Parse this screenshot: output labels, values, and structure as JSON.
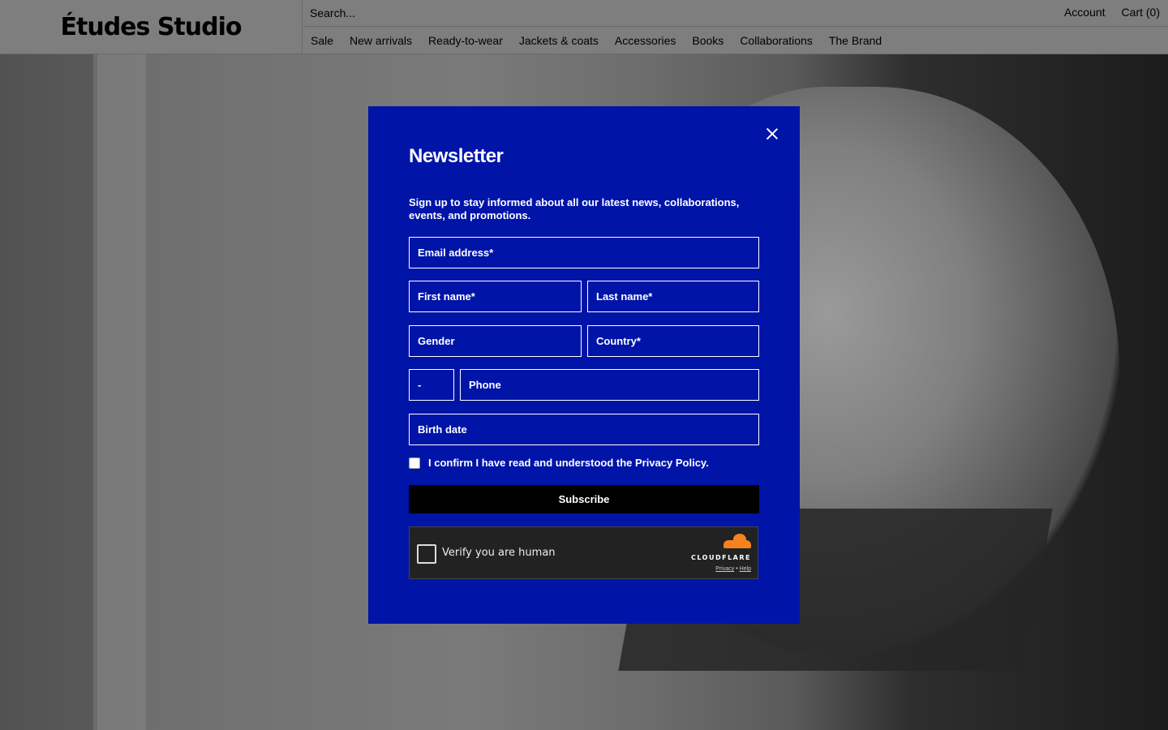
{
  "header": {
    "logo": "Études Studio",
    "search_placeholder": "Search...",
    "account": "Account",
    "cart": "Cart (0)",
    "nav": [
      "Sale",
      "New arrivals",
      "Ready-to-wear",
      "Jackets & coats",
      "Accessories",
      "Books",
      "Collaborations",
      "The Brand"
    ]
  },
  "modal": {
    "title": "Newsletter",
    "description": "Sign up to stay informed about all our latest news, collaborations, events, and promotions.",
    "email_placeholder": "Email address*",
    "first_name_placeholder": "First name*",
    "last_name_placeholder": "Last name*",
    "gender": "Gender",
    "country": "Country*",
    "phone_prefix": "-",
    "phone_placeholder": "Phone",
    "birth_date_placeholder": "Birth date",
    "consent": "I confirm I have read and understood the Privacy Policy.",
    "subscribe": "Subscribe",
    "captcha": {
      "label": "Verify you are human",
      "brand": "CLOUDFLARE",
      "privacy": "Privacy",
      "separator": "•",
      "help": "Help"
    }
  },
  "colors": {
    "modal_bg": "#0014a8",
    "subscribe_bg": "#000000",
    "cloudflare_orange": "#f6821f"
  }
}
